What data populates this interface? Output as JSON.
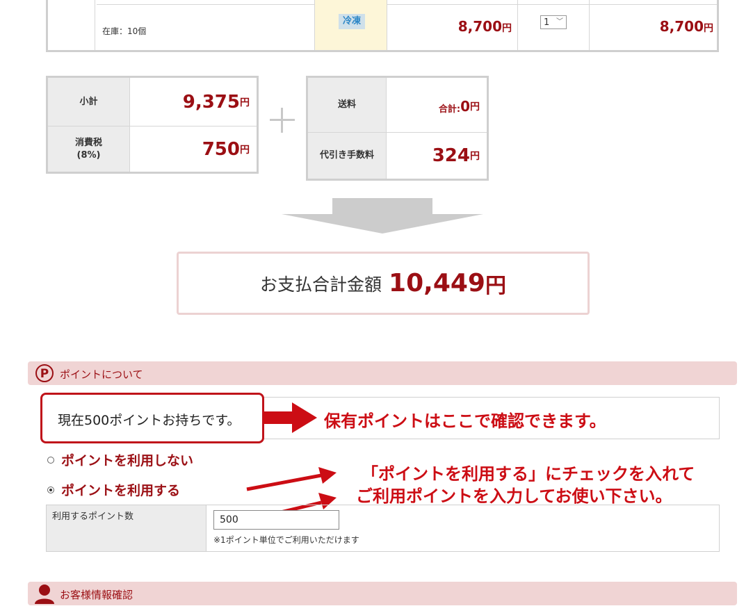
{
  "cart_row": {
    "stock": "在庫：10個",
    "frozen_badge": "冷凍",
    "unit_price": "8,700",
    "quantity": "1",
    "line_total": "8,700",
    "yen": "円"
  },
  "summary_left": {
    "subtotal_label": "小計",
    "subtotal_value": "9,375",
    "tax_label_1": "消費税",
    "tax_label_2": "(8%)",
    "tax_value": "750",
    "yen": "円"
  },
  "summary_right": {
    "shipping_label": "送料",
    "shipping_prefix": "合計:",
    "shipping_value": "0",
    "cod_label": "代引き手数料",
    "cod_value": "324",
    "yen": "円"
  },
  "total": {
    "label": "お支払合計金額",
    "amount": "10,449",
    "yen": "円"
  },
  "points_section": {
    "header_icon_letter": "P",
    "title": "ポイントについて",
    "current_points": "現在500ポイントお持ちです。",
    "annotation_1": "保有ポイントはここで確認できます。",
    "radio_not_use": "ポイントを利用しない",
    "radio_use": "ポイントを利用する",
    "annotation_2_line1": "「ポイントを利用する」にチェックを入れて",
    "annotation_2_line2": "ご利用ポイントを入力してお使い下さい。",
    "use_label": "利用するポイント数",
    "use_value": "500",
    "use_note": "※1ポイント単位でご利用いただけます"
  },
  "customer_section": {
    "title": "お客様情報確認"
  },
  "colors": {
    "accent": "#9b0f14",
    "annotation_red": "#cc0d14",
    "section_bg": "#f0d4d4",
    "label_bg": "#ececec",
    "frozen_bg": "#fdf6d8"
  }
}
